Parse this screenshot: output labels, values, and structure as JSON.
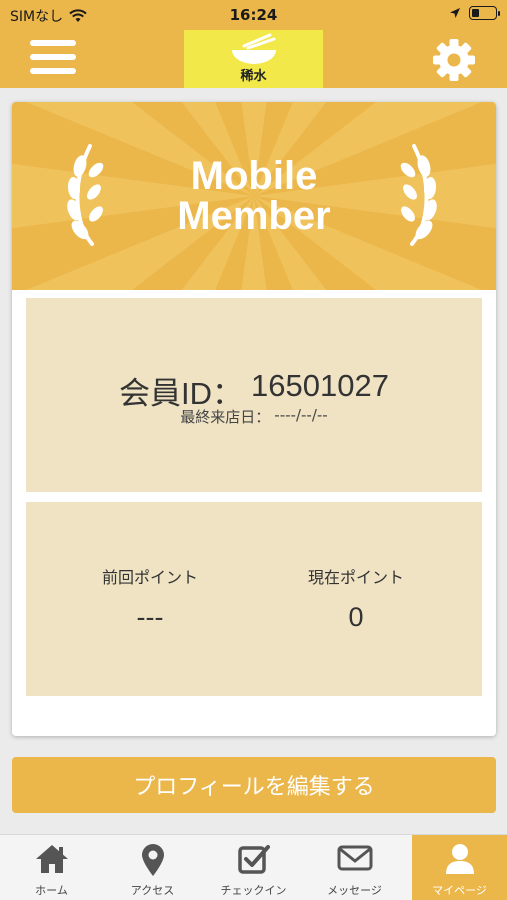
{
  "status_bar": {
    "carrier": "SIMなし",
    "time": "16:24"
  },
  "header": {
    "logo_text": "稀水",
    "menu_icon": "hamburger-icon",
    "settings_icon": "gear-icon"
  },
  "member_card": {
    "banner_title_line1": "Mobile",
    "banner_title_line2": "Member",
    "member_id_label": "会員ID：",
    "member_id_value": "16501027",
    "last_visit_label": "最終来店日：",
    "last_visit_value": "----/--/--",
    "prev_points_label": "前回ポイント",
    "prev_points_value": "---",
    "current_points_label": "現在ポイント",
    "current_points_value": "0"
  },
  "edit_profile_button": "プロフィールを編集する",
  "tabs": [
    {
      "label": "ホーム",
      "icon": "home-icon"
    },
    {
      "label": "アクセス",
      "icon": "map-pin-icon"
    },
    {
      "label": "チェックイン",
      "icon": "checkbox-icon"
    },
    {
      "label": "メッセージ",
      "icon": "envelope-icon"
    },
    {
      "label": "マイページ",
      "icon": "user-icon"
    }
  ],
  "colors": {
    "brand": "#ebb64a",
    "panel": "#efe3c4",
    "logo_bg": "#f3e84a"
  }
}
